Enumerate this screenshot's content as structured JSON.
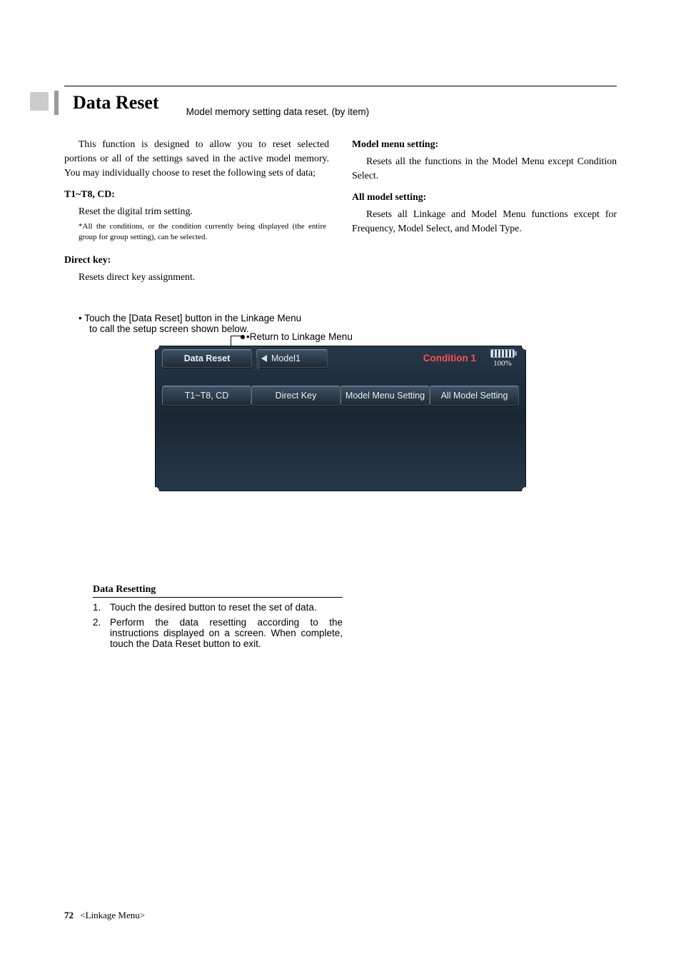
{
  "page": {
    "number": "72",
    "section": "<Linkage Menu>"
  },
  "title": "Data Reset",
  "subtitle": "Model memory setting data reset. (by item)",
  "left_col": {
    "intro": "This function is designed to allow you to reset selected portions or all of the settings saved in the active model memory. You may individually choose to reset the following sets of data;",
    "h1": "T1~T8, CD:",
    "p1": "Reset the digital trim setting.",
    "fine": "*All the conditions, or the condition currently being displayed (the entire group for group setting), can be selected.",
    "h2": "Direct key:",
    "p2": "Resets direct key assignment."
  },
  "right_col": {
    "h1": "Model menu setting:",
    "p1": "Resets all the functions in the Model Menu except Condition Select.",
    "h2": "All model setting:",
    "p2": "Resets all Linkage and Model Menu functions except for Frequency, Model Select, and Model Type."
  },
  "instructions": {
    "bullet": "Touch the [Data Reset] button in the Linkage Menu to call the setup screen shown below.",
    "callout": "Return to Linkage Menu"
  },
  "screen": {
    "header_button": "Data Reset",
    "nav_label": "Model1",
    "condition": "Condition 1",
    "battery_pct": "100%",
    "tabs": [
      "T1~T8, CD",
      "Direct Key",
      "Model Menu Setting",
      "All Model Setting"
    ]
  },
  "resetting": {
    "title": "Data Resetting",
    "steps": [
      "Touch the desired button to reset the set of data.",
      "Perform the data resetting according to the instructions displayed on a screen. When complete, touch the Data Reset button to exit."
    ]
  }
}
